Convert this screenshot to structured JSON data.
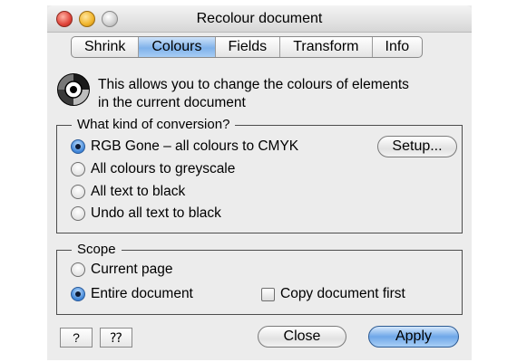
{
  "window": {
    "title": "Recolour document"
  },
  "tabs": [
    "Shrink",
    "Colours",
    "Fields",
    "Transform",
    "Info"
  ],
  "active_tab": "Colours",
  "intro": {
    "icon": "colour-wheel-icon",
    "text_line1": "This allows you to change the colours of elements",
    "text_line2": "in the current document"
  },
  "conversion": {
    "legend": "What kind of conversion?",
    "options": [
      {
        "label": "RGB Gone – all colours to CMYK",
        "selected": true
      },
      {
        "label": "All colours to greyscale",
        "selected": false
      },
      {
        "label": "All text to black",
        "selected": false
      },
      {
        "label": "Undo all text to black",
        "selected": false
      }
    ],
    "setup_button": "Setup..."
  },
  "scope": {
    "legend": "Scope",
    "options": [
      {
        "label": "Current page",
        "selected": false
      },
      {
        "label": "Entire document",
        "selected": true
      }
    ],
    "copy_first": {
      "label": "Copy document first",
      "checked": false
    }
  },
  "footer": {
    "help_button": "?",
    "help2_button": "⁇",
    "close_button": "Close",
    "apply_button": "Apply"
  }
}
